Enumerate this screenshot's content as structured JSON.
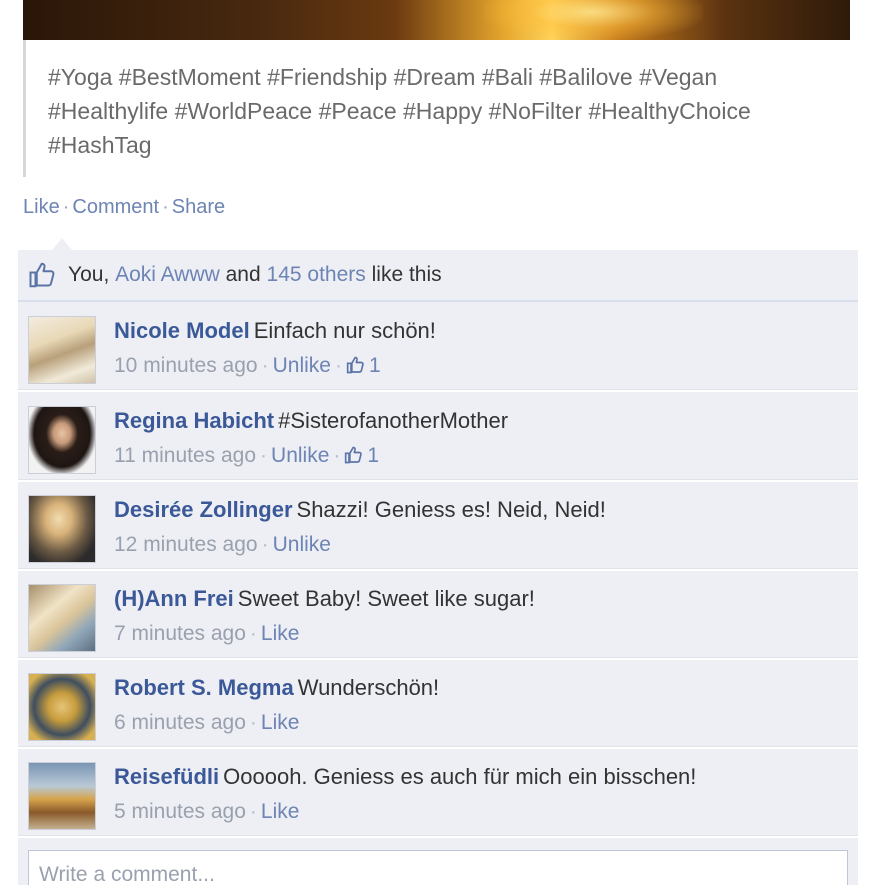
{
  "post": {
    "caption_lines": [
      "#Yoga #BestMoment #Friendship #Dream #Bali #Balilove #Vegan",
      "#Healthylife #WorldPeace #Peace #Happy #NoFilter #HealthyChoice",
      "#HashTag"
    ],
    "actions": {
      "like": "Like",
      "comment": "Comment",
      "share": "Share",
      "separator": "·"
    }
  },
  "likes": {
    "you": "You,",
    "person": "Aoki Awww",
    "and": "and",
    "others": "145 others",
    "suffix": "like this"
  },
  "comments": [
    {
      "name": "Nicole Model",
      "text": "Einfach nur schön!",
      "time": "10 minutes ago",
      "action": "Unlike",
      "like_count": "1"
    },
    {
      "name": "Regina Habicht",
      "text": "#SisterofanotherMother",
      "time": "11 minutes ago",
      "action": "Unlike",
      "like_count": "1"
    },
    {
      "name": "Desirée Zollinger",
      "text": "Shazzi! Geniess es! Neid, Neid!",
      "time": "12 minutes ago",
      "action": "Unlike",
      "like_count": ""
    },
    {
      "name": "(H)Ann Frei",
      "text": "Sweet Baby! Sweet like sugar!",
      "time": "7 minutes ago",
      "action": "Like",
      "like_count": ""
    },
    {
      "name": "Robert S. Megma",
      "text": "Wunderschön!",
      "time": "6 minutes ago",
      "action": "Like",
      "like_count": ""
    },
    {
      "name": "Reisefüdli",
      "text": "Oooooh. Geniess es auch für mich ein bisschen!",
      "time": "5 minutes ago",
      "action": "Like",
      "like_count": ""
    }
  ],
  "write_comment": {
    "placeholder": "Write a comment..."
  },
  "colors": {
    "link": "#3b5998",
    "action": "#6d84b4",
    "panel": "#edeff4",
    "meta": "#9aa1ae"
  },
  "icons": {
    "like": "thumbs-up-icon"
  }
}
